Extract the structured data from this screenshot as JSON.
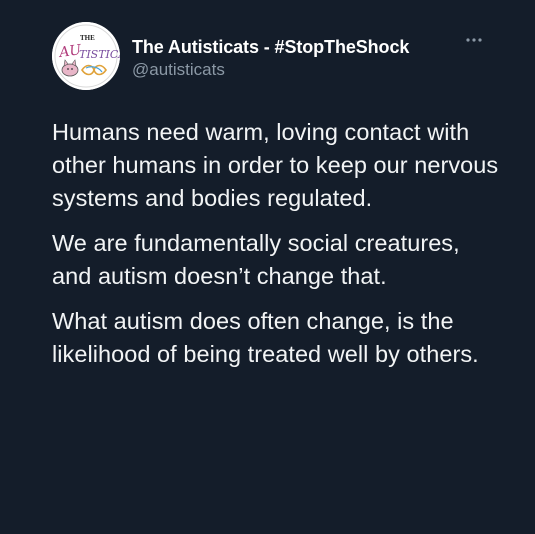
{
  "tweet": {
    "author": {
      "display_name": "The Autisticats - #StopTheShock",
      "handle": "@autisticats",
      "avatar_icon": "autisticats-logo-icon",
      "avatar_logo_text": "THE AUTISTICATS"
    },
    "more_icon": "more-options-icon",
    "paragraphs": [
      "Humans need warm, loving contact with other humans in order to keep our nervous systems and bodies regulated.",
      "We are fundamentally social creatures, and autism doesn’t change that.",
      "What autism does often change, is the likelihood of being treated well by others."
    ]
  },
  "colors": {
    "background": "#141d2a",
    "primary_text": "#f2f4f5",
    "secondary_text": "#8b98a5"
  }
}
